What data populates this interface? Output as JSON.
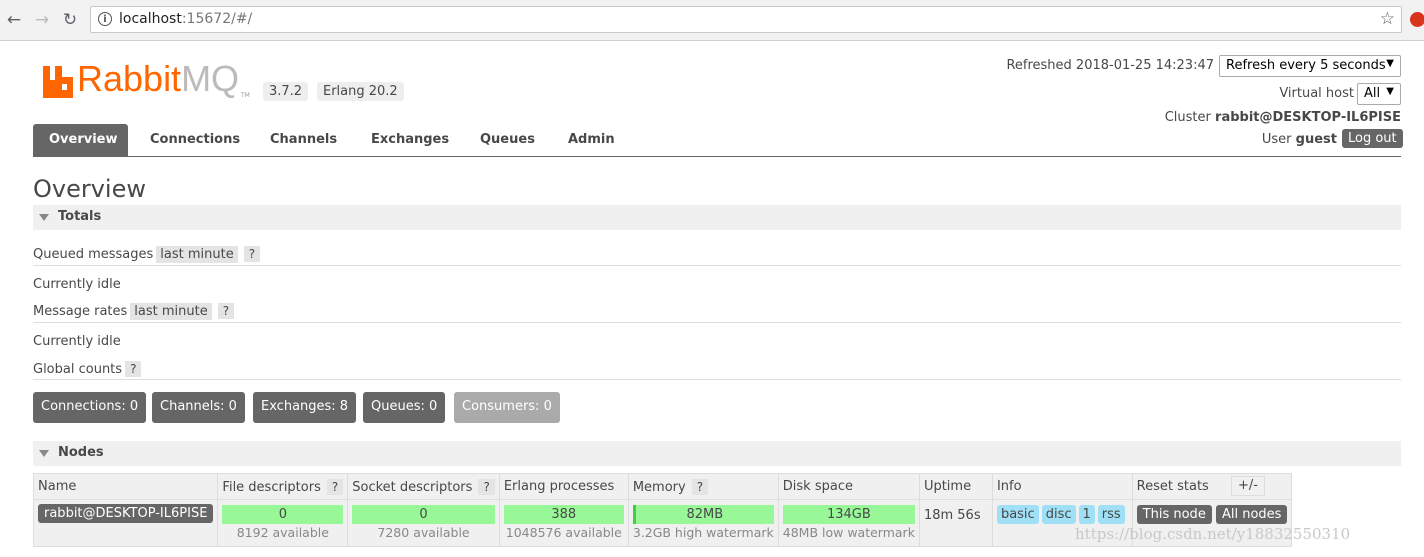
{
  "browser": {
    "url_host": "localhost",
    "url_rest": ":15672/#/"
  },
  "header": {
    "logo_text_rabbit": "Rabbit",
    "logo_text_mq": "MQ",
    "logo_tm": "TM",
    "version": "3.7.2",
    "erlang": "Erlang 20.2",
    "refreshed": "Refreshed 2018-01-25 14:23:47",
    "refresh_select": "Refresh every 5 seconds",
    "virtual_host_label": "Virtual host",
    "virtual_host_value": "All",
    "cluster_label": "Cluster",
    "cluster_value": "rabbit@DESKTOP-IL6PISE",
    "user_label": "User",
    "user_value": "guest",
    "logout": "Log out"
  },
  "tabs": [
    "Overview",
    "Connections",
    "Channels",
    "Exchanges",
    "Queues",
    "Admin"
  ],
  "page_title": "Overview",
  "totals": {
    "section_title": "Totals",
    "queued_label": "Queued messages",
    "queued_range": "last minute",
    "help": "?",
    "idle1": "Currently idle",
    "rates_label": "Message rates",
    "rates_range": "last minute",
    "idle2": "Currently idle",
    "global_label": "Global counts",
    "counts": [
      "Connections: 0",
      "Channels: 0",
      "Exchanges: 8",
      "Queues: 0",
      "Consumers: 0"
    ]
  },
  "nodes": {
    "section_title": "Nodes",
    "columns": [
      "Name",
      "File descriptors",
      "Socket descriptors",
      "Erlang processes",
      "Memory",
      "Disk space",
      "Uptime",
      "Info",
      "Reset stats"
    ],
    "row": {
      "name": "rabbit@DESKTOP-IL6PISE",
      "file_desc": "0",
      "file_desc_sub": "8192 available",
      "socket_desc": "0",
      "socket_desc_sub": "7280 available",
      "erlang_proc": "388",
      "erlang_proc_sub": "1048576 available",
      "memory": "82MB",
      "memory_sub": "3.2GB high watermark",
      "disk": "134GB",
      "disk_sub": "48MB low watermark",
      "uptime": "18m 56s",
      "info_tags": [
        "basic",
        "disc",
        "1",
        "rss"
      ],
      "reset_this": "This node",
      "reset_all": "All nodes"
    },
    "toggle_columns": "+/-"
  },
  "watermark": "https://blog.csdn.net/y18832550310"
}
